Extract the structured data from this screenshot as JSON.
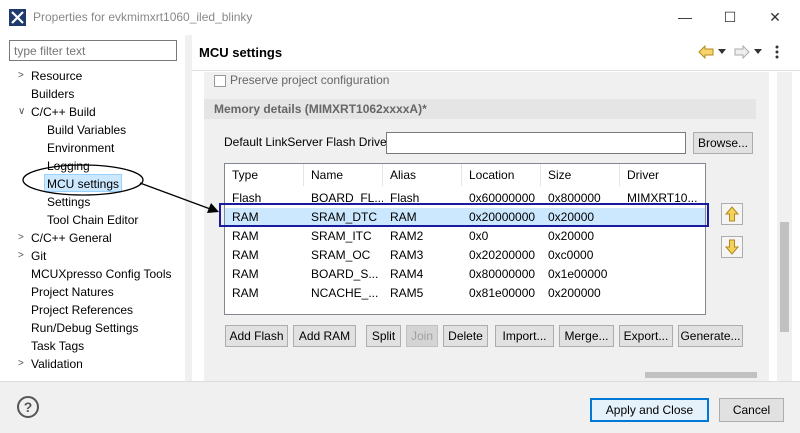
{
  "window": {
    "title": "Properties for evkmimxrt1060_iled_blinky",
    "minimize_glyph": "—",
    "maximize_glyph": "☐",
    "close_glyph": "✕"
  },
  "left": {
    "filter_placeholder": "type filter text",
    "tree": [
      {
        "label": "Resource",
        "arrow": ">"
      },
      {
        "label": "Builders",
        "arrow": ""
      },
      {
        "label": "C/C++ Build",
        "arrow": "∨"
      },
      {
        "label": "Build Variables",
        "arrow": ""
      },
      {
        "label": "Environment",
        "arrow": ""
      },
      {
        "label": "Logging",
        "arrow": ""
      },
      {
        "label": "MCU settings",
        "arrow": ""
      },
      {
        "label": "Settings",
        "arrow": ""
      },
      {
        "label": "Tool Chain Editor",
        "arrow": ""
      },
      {
        "label": "C/C++ General",
        "arrow": ">"
      },
      {
        "label": "Git",
        "arrow": ">"
      },
      {
        "label": "MCUXpresso Config Tools",
        "arrow": ""
      },
      {
        "label": "Project Natures",
        "arrow": ""
      },
      {
        "label": "Project References",
        "arrow": ""
      },
      {
        "label": "Run/Debug Settings",
        "arrow": ""
      },
      {
        "label": "Task Tags",
        "arrow": ""
      },
      {
        "label": "Validation",
        "arrow": ">"
      }
    ]
  },
  "right": {
    "title": "MCU settings",
    "preserve_label": "Preserve project configuration",
    "section_title": "Memory details (MIMXRT1062xxxxA)*",
    "driver_label": "Default LinkServer Flash Driver",
    "driver_value": "",
    "browse_label": "Browse...",
    "table": {
      "headers": [
        "Type",
        "Name",
        "Alias",
        "Location",
        "Size",
        "Driver"
      ],
      "rows": [
        [
          "Flash",
          "BOARD_FL...",
          "Flash",
          "0x60000000",
          "0x800000",
          "MIMXRT10..."
        ],
        [
          "RAM",
          "SRAM_DTC",
          "RAM",
          "0x20000000",
          "0x20000",
          ""
        ],
        [
          "RAM",
          "SRAM_ITC",
          "RAM2",
          "0x0",
          "0x20000",
          ""
        ],
        [
          "RAM",
          "SRAM_OC",
          "RAM3",
          "0x20200000",
          "0xc0000",
          ""
        ],
        [
          "RAM",
          "BOARD_S...",
          "RAM4",
          "0x80000000",
          "0x1e00000",
          ""
        ],
        [
          "RAM",
          "NCACHE_...",
          "RAM5",
          "0x81e00000",
          "0x200000",
          ""
        ]
      ],
      "selected_row": 1
    },
    "buttons": {
      "add_flash": "Add Flash",
      "add_ram": "Add RAM",
      "split": "Split",
      "join": "Join",
      "delete": "Delete",
      "import": "Import...",
      "merge": "Merge...",
      "export": "Export...",
      "generate": "Generate..."
    }
  },
  "bottom": {
    "help_glyph": "?",
    "apply_close": "Apply and Close",
    "cancel": "Cancel"
  }
}
